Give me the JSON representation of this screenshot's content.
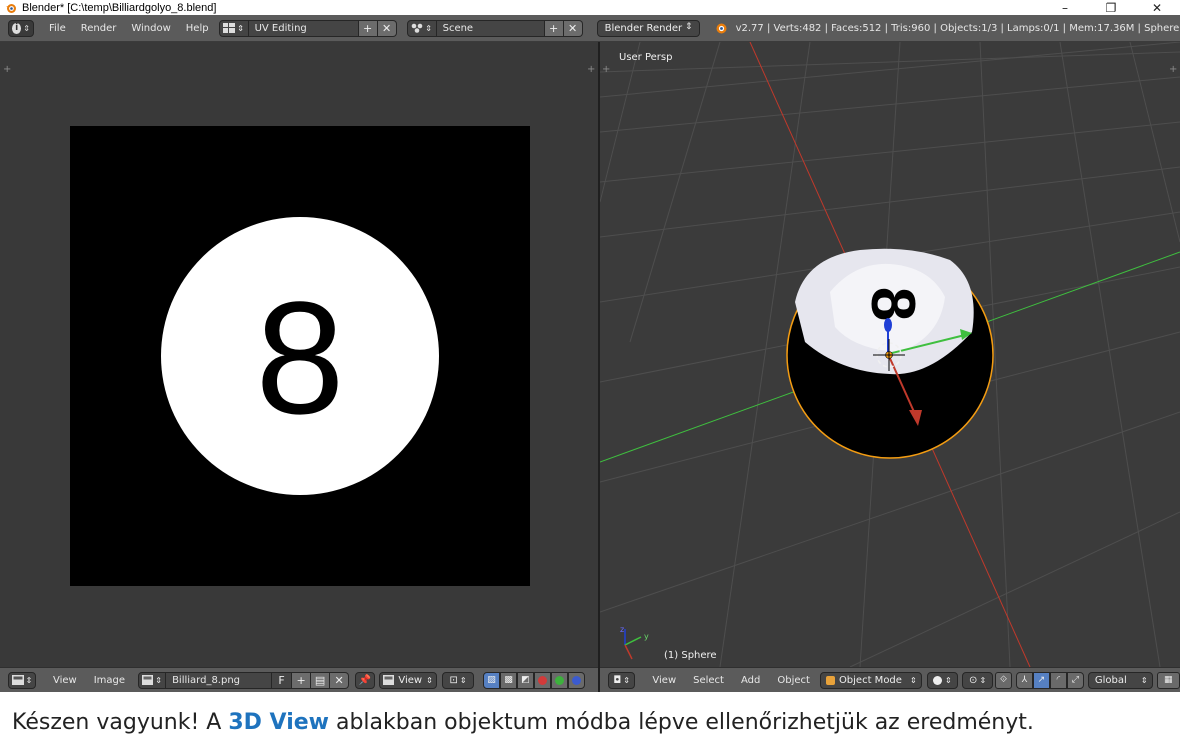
{
  "window": {
    "title": "Blender* [C:\\temp\\Billiardgolyo_8.blend]",
    "minimize": "–",
    "restore": "❐",
    "close": "✕"
  },
  "info_header": {
    "editor_icon": "info-icon",
    "menus": [
      "File",
      "Render",
      "Window",
      "Help"
    ],
    "layout": "UV Editing",
    "scene": "Scene",
    "render_engine": "Blender Render",
    "stats": "v2.77 | Verts:482 | Faces:512 | Tris:960 | Objects:1/3 | Lamps:0/1 | Mem:17.36M | Sphere"
  },
  "uv_editor": {
    "image_label": "8",
    "image_colors": {
      "background": "#000000",
      "circle": "#ffffff",
      "number": "#000000"
    },
    "header": {
      "menus": [
        "View",
        "Image"
      ],
      "image_name": "Billiard_8.png",
      "fake_user": "F",
      "view_mode": "View"
    }
  },
  "view3d": {
    "viewport_label": "User Persp",
    "object_label": "(1) Sphere",
    "colors": {
      "x_axis": "#c0392b",
      "y_axis": "#3fbf3f",
      "z_axis": "#1f3fd6",
      "selection_outline": "#f39c12"
    },
    "header": {
      "menus": [
        "View",
        "Select",
        "Add",
        "Object"
      ],
      "mode": "Object Mode",
      "orientation": "Global"
    }
  },
  "caption": {
    "before": "Készen vagyunk! A ",
    "highlight": "3D View",
    "after": " ablakban objektum módba lépve ellenőrizhetjük az eredményt."
  }
}
